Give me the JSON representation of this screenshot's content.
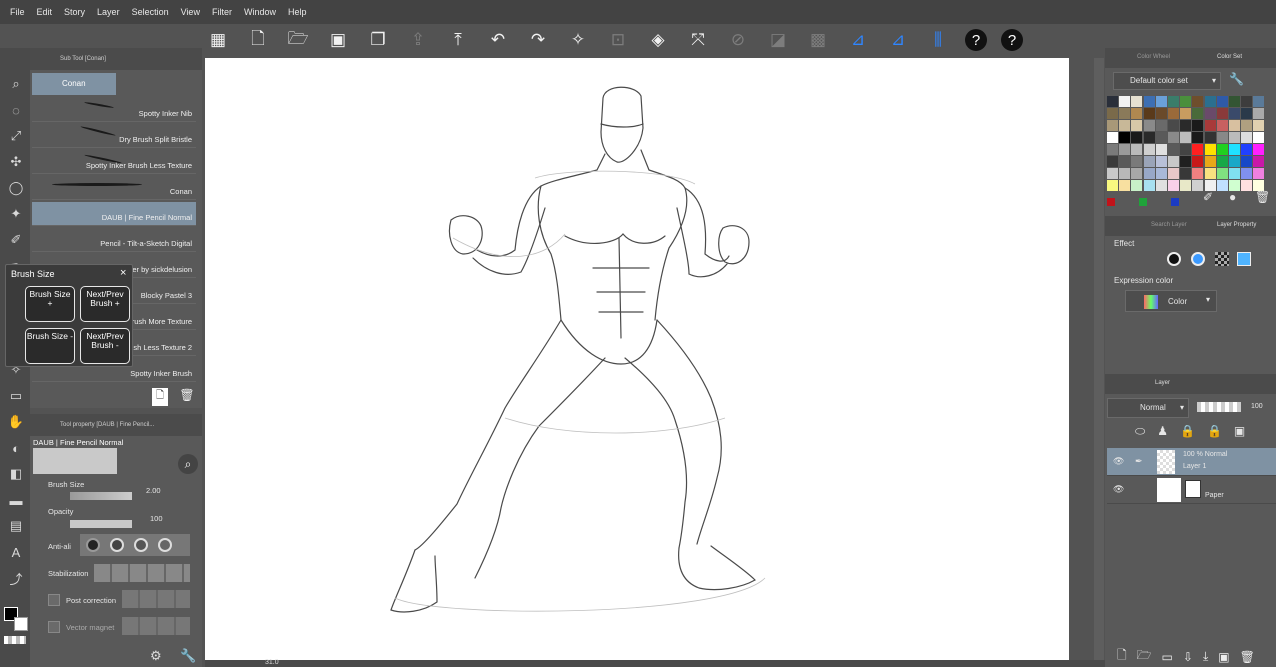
{
  "menu": [
    "File",
    "Edit",
    "Story",
    "Layer",
    "Selection",
    "View",
    "Filter",
    "Window",
    "Help"
  ],
  "subtool": {
    "tab": "Sub Tool [Conan]",
    "current": "Conan",
    "brushes": [
      "Spotty Inker Nib",
      "Dry Brush Split Bristle",
      "Spotty Inker Brush Less Texture",
      "Conan",
      "DAUB | Fine Pencil Normal",
      "Pencil - Tilt-a-Sketch Digital",
      "Brush Scatter by sickdelusion",
      "Blocky Pastel 3",
      "Brush More Texture",
      "Spotty Inker Brush Less Texture 2",
      "Spotty Inker Brush"
    ]
  },
  "popup": {
    "title": "Brush Size",
    "close": "×",
    "b1": "Brush Size +",
    "b2": "Next/Prev Brush +",
    "b3": "Brush Size -",
    "b4": "Next/Prev Brush -"
  },
  "toolprop": {
    "tab": "Tool property [DAUB | Fine Pencil...",
    "brush_name": "DAUB | Fine Pencil Normal",
    "brush_size_label": "Brush Size",
    "brush_size_value": "2.00",
    "opacity_label": "Opacity",
    "opacity_value": "100",
    "antialias_label": "Anti-ali",
    "stabilization_label": "Stabilization",
    "post_correction_label": "Post correction",
    "vector_magnet_label": "Vector magnet"
  },
  "colorset": {
    "tab1": "Color Wheel",
    "tab2": "Color Set",
    "set_name": "Default color set"
  },
  "layer_property": {
    "tab1": "Search Layer",
    "tab2": "Layer Property",
    "effect_label": "Effect",
    "expression_label": "Expression color",
    "expression_value": "Color"
  },
  "layers": {
    "tab": "Layer",
    "blend_mode": "Normal",
    "opacity": "100",
    "items": [
      {
        "top": "100 %  Normal",
        "name": "Layer 1"
      },
      {
        "top": "",
        "name": "Paper"
      }
    ]
  },
  "status": {
    "zoom": "31.0"
  }
}
